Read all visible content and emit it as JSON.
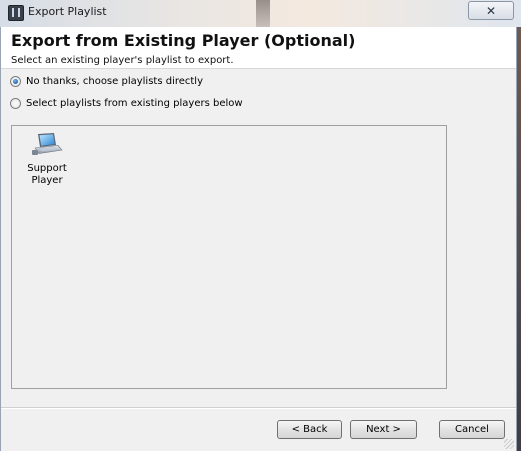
{
  "window": {
    "title": "Export Playlist",
    "close_glyph": "✕"
  },
  "header": {
    "title": "Export from Existing Player (Optional)",
    "subtitle": "Select an existing player's playlist to export."
  },
  "options": [
    {
      "label": "No thanks, choose playlists directly",
      "checked": true
    },
    {
      "label": "Select playlists from existing players below",
      "checked": false
    }
  ],
  "players": [
    {
      "name": "Support Player",
      "icon": "laptop-icon"
    }
  ],
  "buttons": {
    "back": "< Back",
    "next": "Next >",
    "cancel": "Cancel"
  },
  "colors": {
    "accent": "#1e63b4",
    "title_bar": "#e9e6e3",
    "client_bg": "#f0f0f0"
  }
}
